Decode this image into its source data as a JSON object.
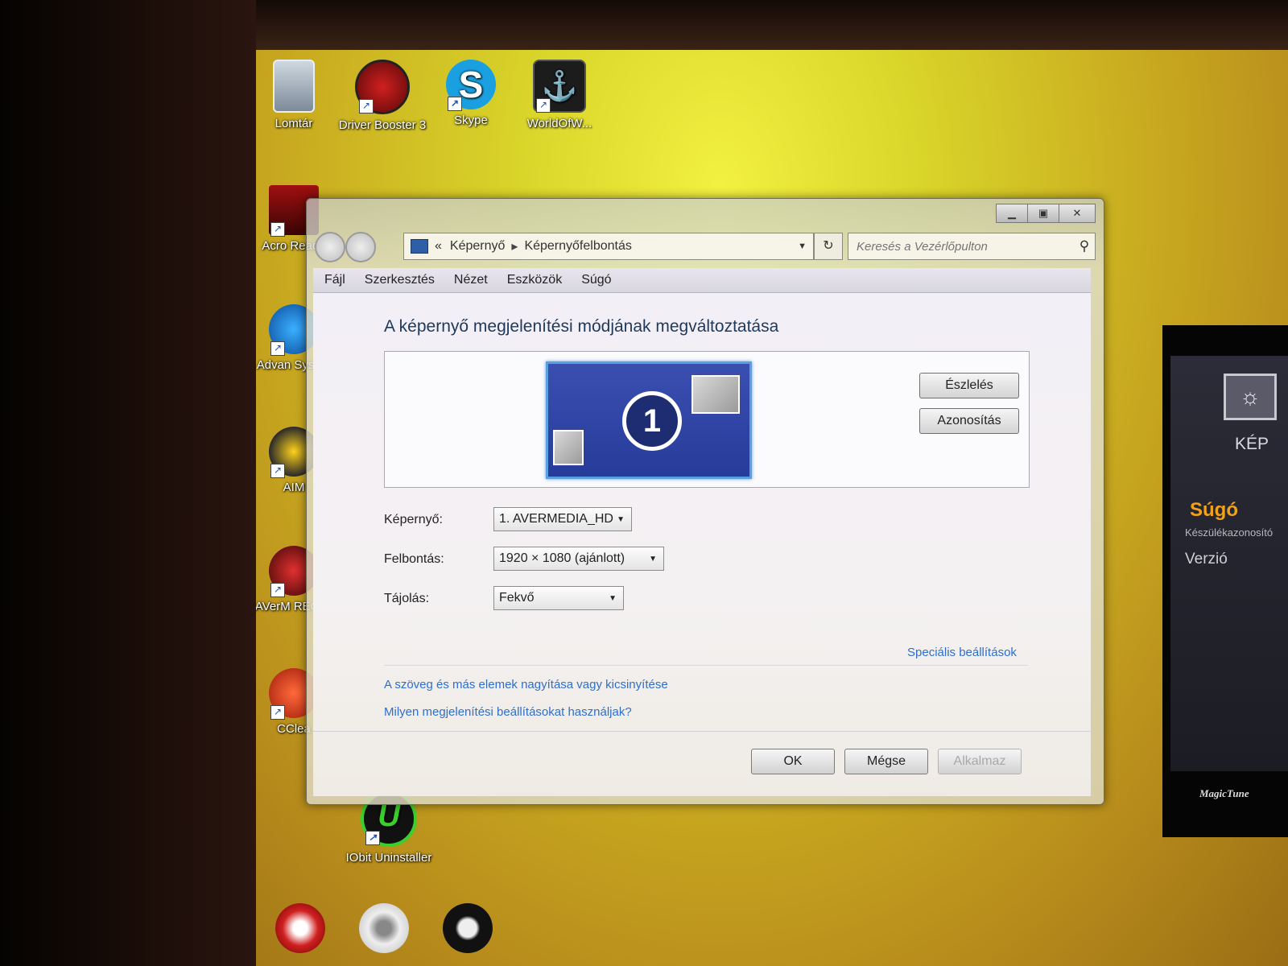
{
  "desktop": {
    "icons": [
      {
        "label": "Lomtár",
        "icon": "recycle-bin-icon"
      },
      {
        "label": "Driver Booster 3",
        "icon": "driver-booster-icon"
      },
      {
        "label": "Skype",
        "icon": "skype-icon"
      },
      {
        "label": "WorldOfW...",
        "icon": "world-of-warships-icon"
      },
      {
        "label": "Acro Reade",
        "icon": "acrobat-reader-icon"
      },
      {
        "label": "Advan Systen",
        "icon": "advanced-systemcare-icon"
      },
      {
        "label": "AIM",
        "icon": "aimp-icon"
      },
      {
        "label": "AVerM RECen",
        "icon": "avermedia-recentral-icon"
      },
      {
        "label": "CClea",
        "icon": "ccleaner-icon"
      },
      {
        "label": "IObit Uninstaller",
        "icon": "iobit-uninstaller-icon"
      }
    ]
  },
  "window": {
    "breadcrumb": {
      "prefix": "«",
      "items": [
        "Képernyő",
        "Képernyőfelbontás"
      ],
      "separator": "▸"
    },
    "search_placeholder": "Keresés a Vezérlőpulton",
    "menu": [
      "Fájl",
      "Szerkesztés",
      "Nézet",
      "Eszközök",
      "Súgó"
    ],
    "title": "A képernyő megjelenítési módjának megváltoztatása",
    "monitor_number": "1",
    "detect_label": "Észlelés",
    "identify_label": "Azonosítás",
    "fields": {
      "display_label": "Képernyő:",
      "display_value": "1. AVERMEDIA_HD",
      "resolution_label": "Felbontás:",
      "resolution_value": "1920 × 1080 (ajánlott)",
      "orientation_label": "Tájolás:",
      "orientation_value": "Fekvő"
    },
    "advanced_link": "Speciális beállítások",
    "links": [
      "A szöveg és más elemek nagyítása vagy kicsinyítése",
      "Milyen megjelenítési beállításokat használjak?"
    ],
    "buttons": {
      "ok": "OK",
      "cancel": "Mégse",
      "apply": "Alkalmaz"
    }
  },
  "magictune": {
    "section": "KÉP",
    "help": "Súgó",
    "device_id": "Készülékazonosító",
    "version": "Verzió",
    "logo": "MagicTune"
  },
  "colors": {
    "desktop_yellow": "#e0d830",
    "link_blue": "#2f6fcb",
    "title_blue": "#1e395b",
    "monitor_blue": "#273b9a",
    "magictune_orange": "#f0a21a"
  }
}
